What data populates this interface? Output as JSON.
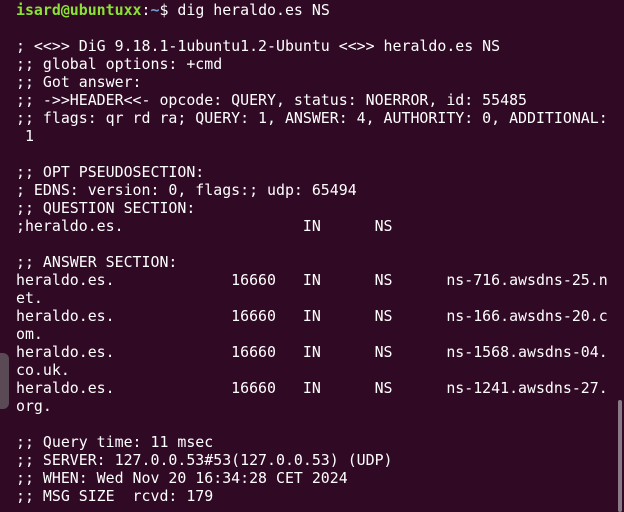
{
  "prompt": {
    "user_host": "isard@ubuntuxx",
    "separator": ":",
    "path": "~",
    "symbol": "$ ",
    "command": "dig heraldo.es NS"
  },
  "output_lines": [
    "",
    "; <<>> DiG 9.18.1-1ubuntu1.2-Ubuntu <<>> heraldo.es NS",
    ";; global options: +cmd",
    ";; Got answer:",
    ";; ->>HEADER<<- opcode: QUERY, status: NOERROR, id: 55485",
    ";; flags: qr rd ra; QUERY: 1, ANSWER: 4, AUTHORITY: 0, ADDITIONAL:",
    " 1",
    "",
    ";; OPT PSEUDOSECTION:",
    "; EDNS: version: 0, flags:; udp: 65494",
    ";; QUESTION SECTION:",
    ";heraldo.es.                    IN      NS",
    "",
    ";; ANSWER SECTION:",
    "heraldo.es.             16660   IN      NS      ns-716.awsdns-25.n",
    "et.",
    "heraldo.es.             16660   IN      NS      ns-166.awsdns-20.c",
    "om.",
    "heraldo.es.             16660   IN      NS      ns-1568.awsdns-04.",
    "co.uk.",
    "heraldo.es.             16660   IN      NS      ns-1241.awsdns-27.",
    "org.",
    "",
    ";; Query time: 11 msec",
    ";; SERVER: 127.0.0.53#53(127.0.0.53) (UDP)",
    ";; WHEN: Wed Nov 20 16:34:28 CET 2024",
    ";; MSG SIZE  rcvd: 179"
  ],
  "colors": {
    "background": "#300a24",
    "text": "#ffffff",
    "prompt_user": "#8ae234",
    "prompt_path": "#729fcf"
  }
}
